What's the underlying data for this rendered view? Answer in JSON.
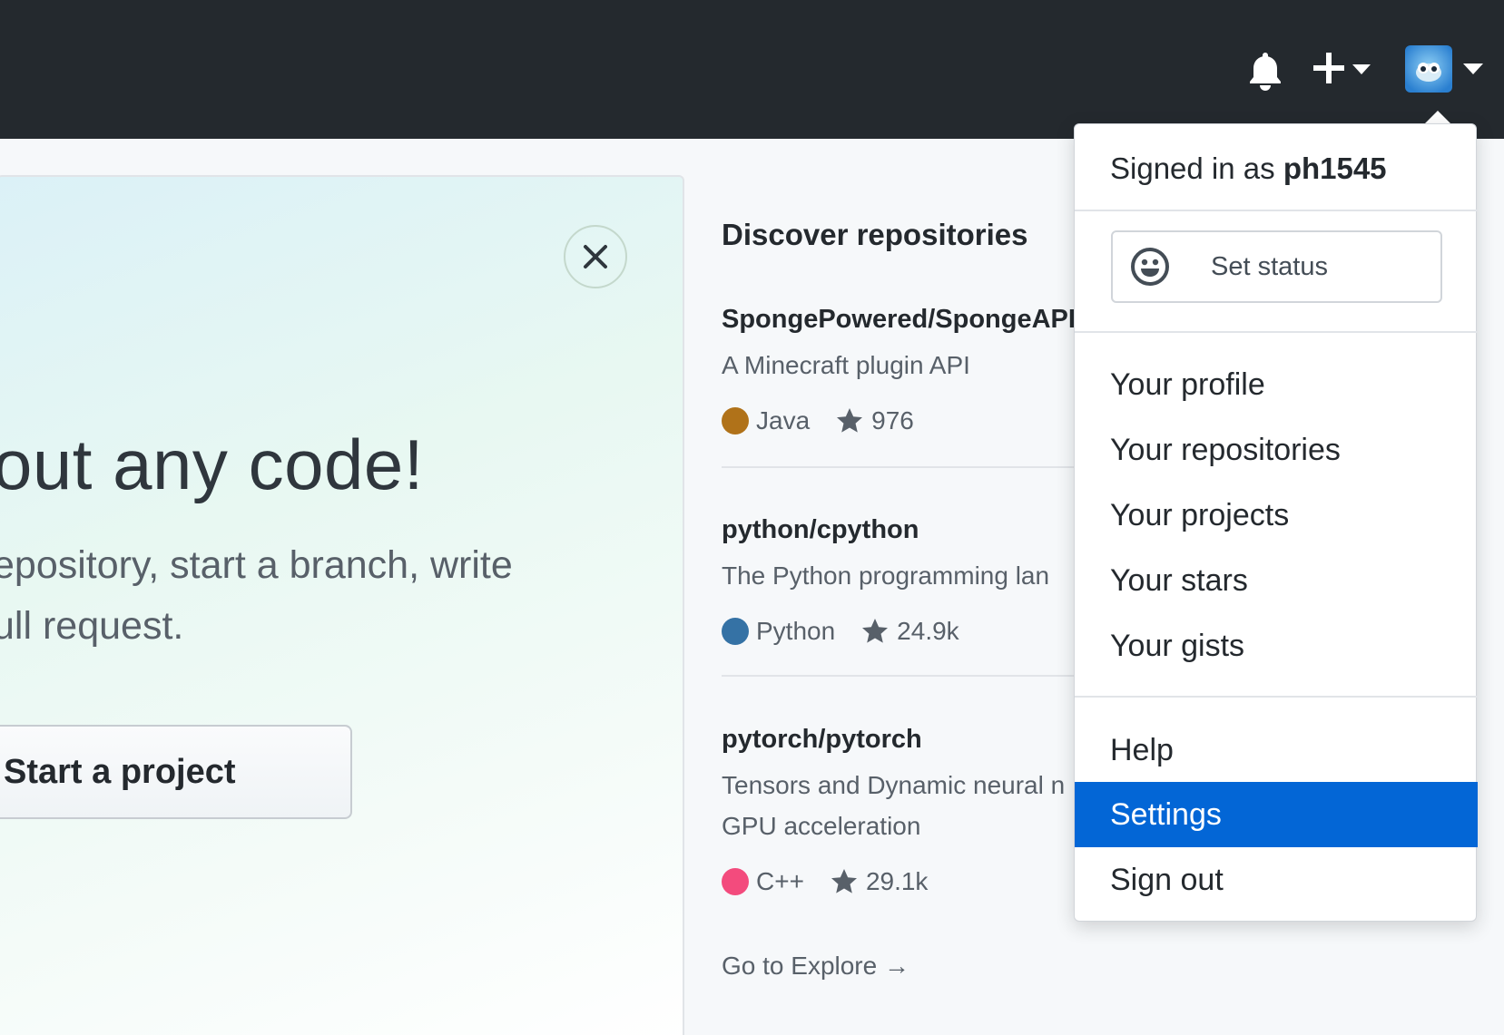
{
  "header": {
    "notifications_icon": "bell-icon",
    "create_icon": "plus-icon",
    "avatar_icon": "user-avatar"
  },
  "hero": {
    "title": "thout any code!",
    "line1": "epository, start a branch, write",
    "line2": "ull request.",
    "start_button": "Start a project"
  },
  "discover": {
    "heading": "Discover repositories",
    "repos": [
      {
        "name": "SpongePowered/SpongeAPI",
        "description": [
          "A Minecraft plugin API"
        ],
        "language": "Java",
        "language_color": "#b07219",
        "stars": "976"
      },
      {
        "name": "python/cpython",
        "description": [
          "The Python programming lan"
        ],
        "language": "Python",
        "language_color": "#3572a5",
        "stars": "24.9k"
      },
      {
        "name": "pytorch/pytorch",
        "description": [
          "Tensors and Dynamic neural n",
          "GPU acceleration"
        ],
        "language": "C++",
        "language_color": "#f34b7d",
        "stars": "29.1k"
      }
    ],
    "explore_link": "Go to Explore →"
  },
  "dropdown": {
    "signed_in_prefix": "Signed in as",
    "username": "ph1545",
    "set_status": "Set status",
    "items_group1": [
      "Your profile",
      "Your repositories",
      "Your projects",
      "Your stars",
      "Your gists"
    ],
    "items_group2": [
      "Help",
      "Settings",
      "Sign out"
    ],
    "active_item": "Settings",
    "accent_color": "#0366d6"
  }
}
